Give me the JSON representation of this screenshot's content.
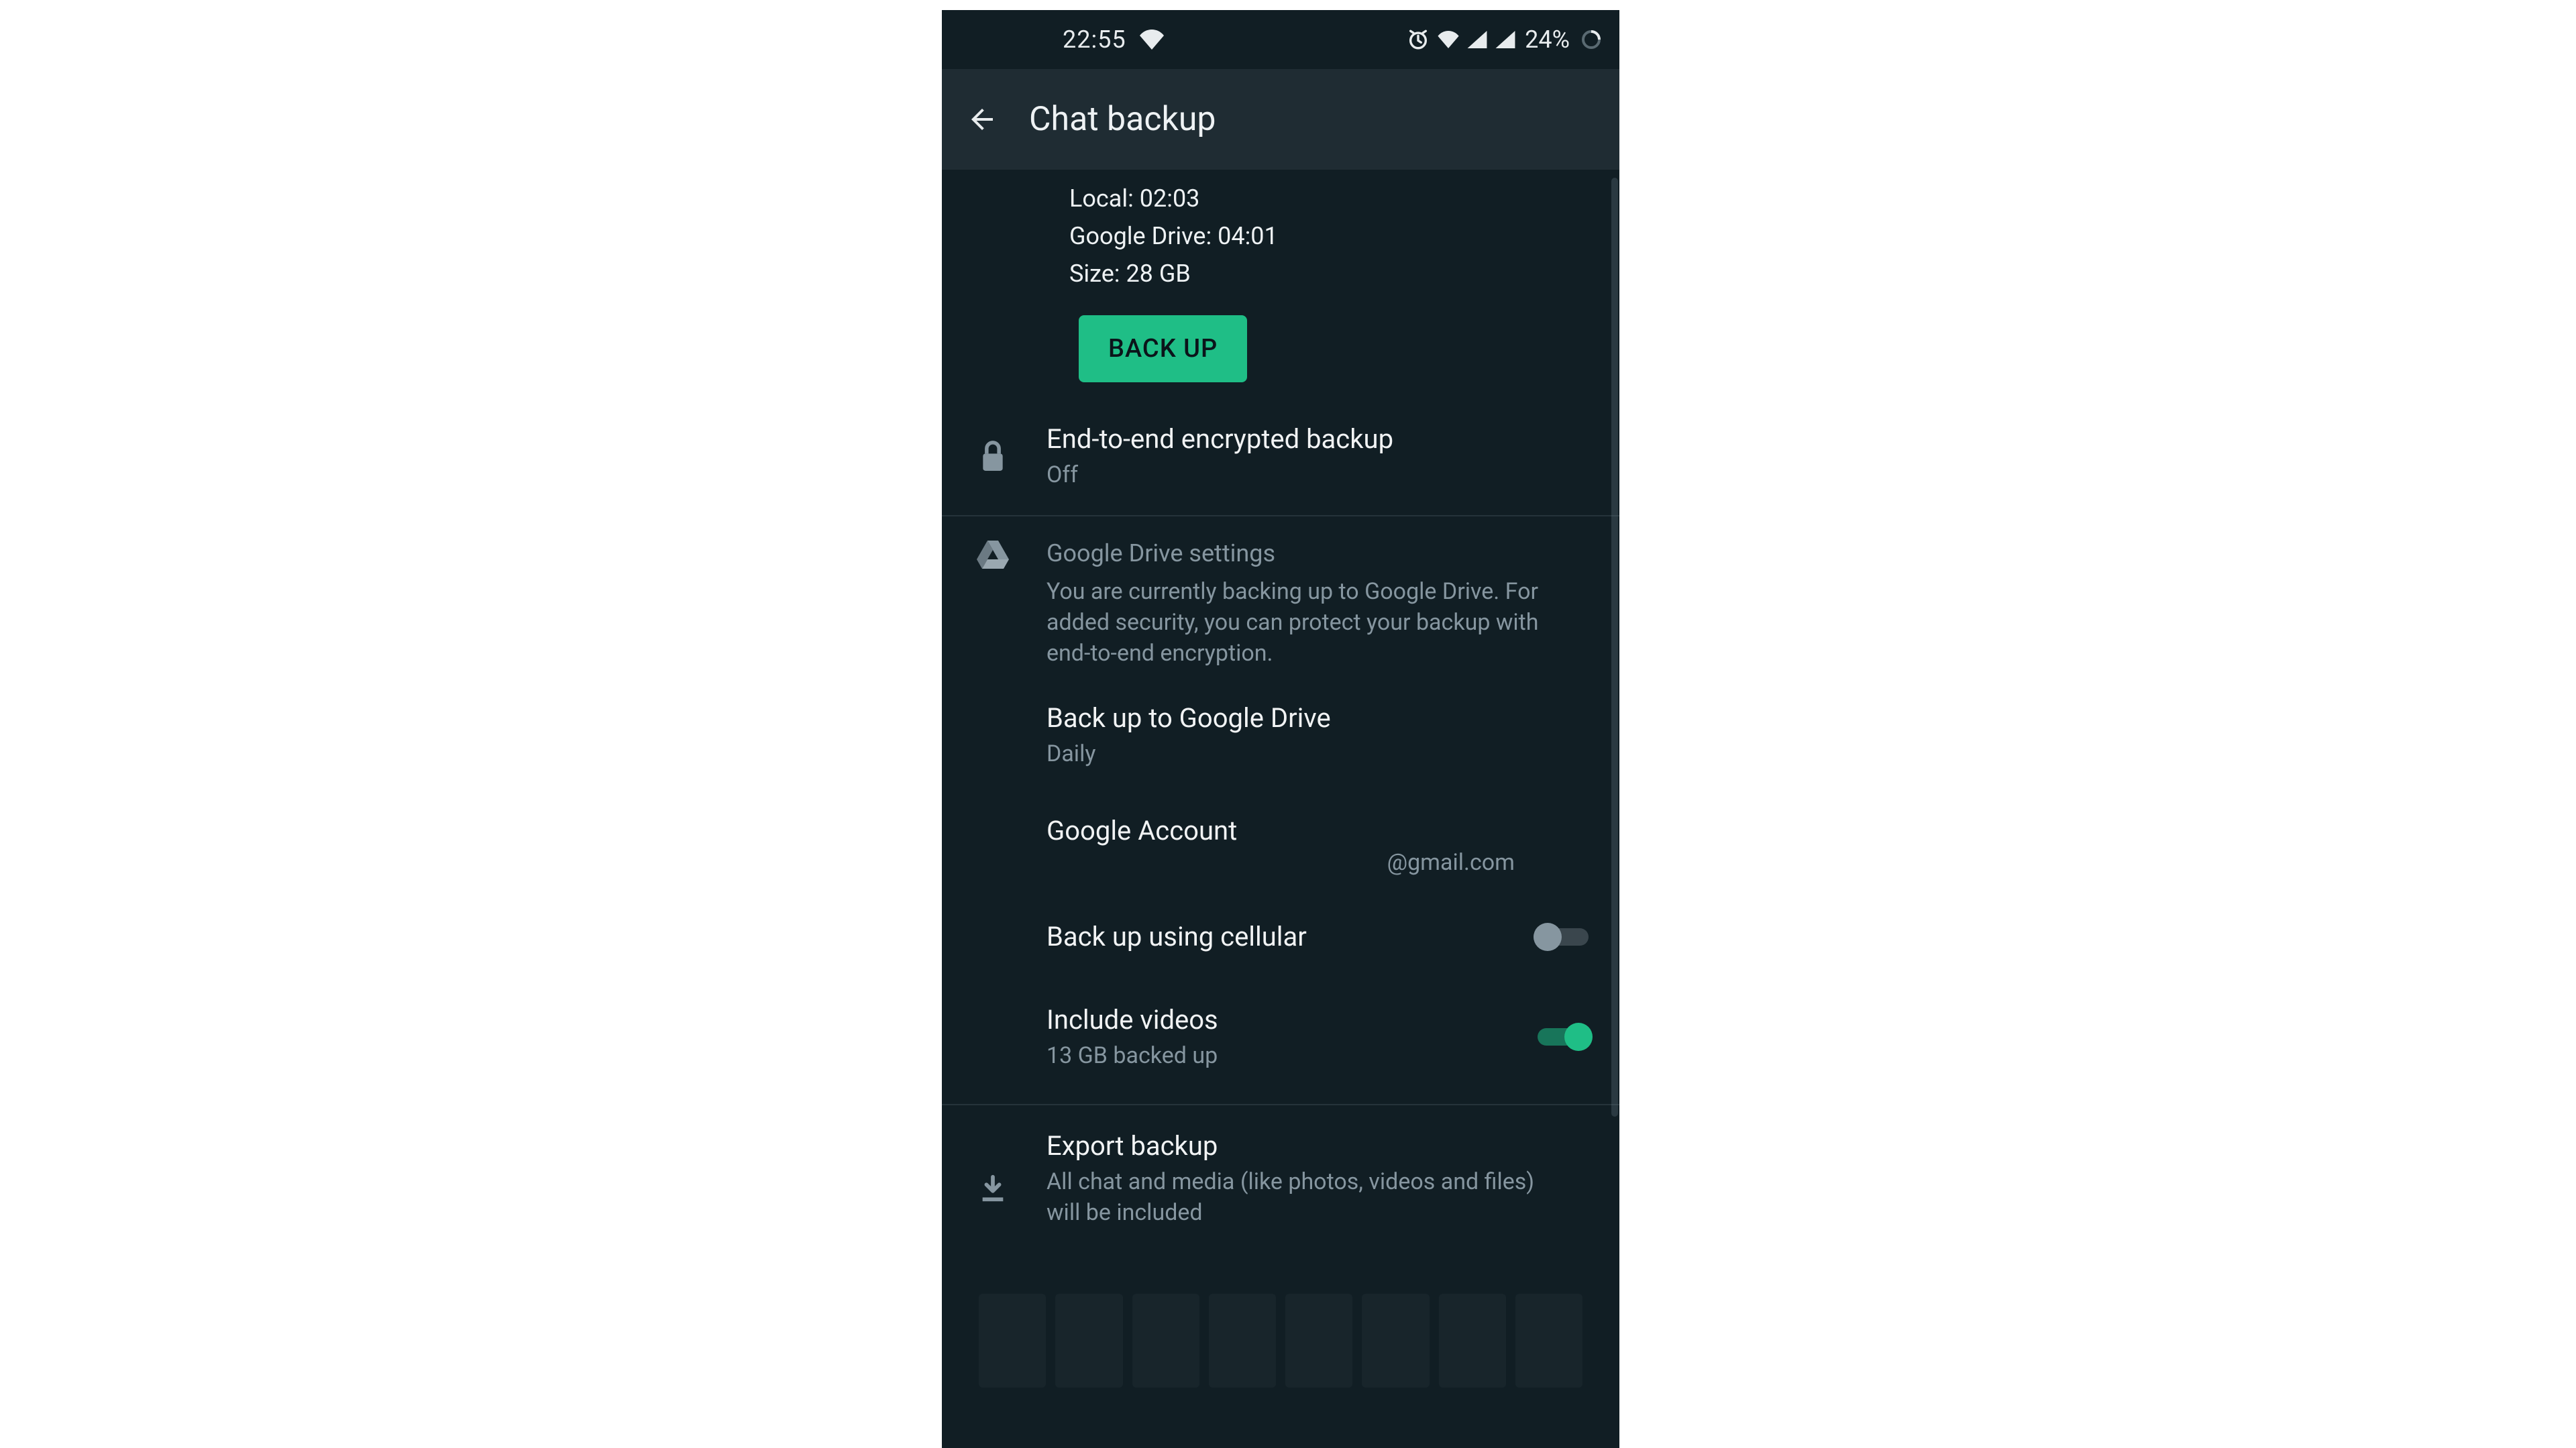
{
  "statusbar": {
    "time": "22:55",
    "battery_text": "24%"
  },
  "appbar": {
    "title": "Chat backup"
  },
  "backup_info": {
    "local_label": "Local:",
    "local_value": "02:03",
    "gdrive_label": "Google Drive:",
    "gdrive_value": "04:01",
    "size_label": "Size:",
    "size_value": "28 GB",
    "button": "BACK UP"
  },
  "e2e": {
    "title": "End-to-end encrypted backup",
    "status": "Off"
  },
  "gdrive": {
    "section_title": "Google Drive settings",
    "section_desc": "You are currently backing up to Google Drive. For added security, you can protect your backup with end-to-end encryption.",
    "freq_title": "Back up to Google Drive",
    "freq_value": "Daily",
    "account_title": "Google Account",
    "account_value": "@gmail.com",
    "cellular_title": "Back up using cellular",
    "cellular_on": false,
    "videos_title": "Include videos",
    "videos_sub": "13 GB backed up",
    "videos_on": true
  },
  "export": {
    "title": "Export backup",
    "desc": "All chat and media (like photos, videos and files) will be included"
  }
}
